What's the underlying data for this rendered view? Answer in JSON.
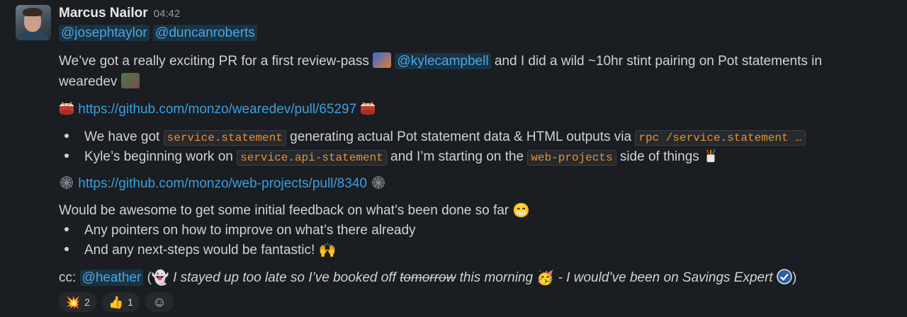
{
  "message": {
    "author": "Marcus Nailor",
    "time": "04:42",
    "mentions_top": [
      "@josephtaylor",
      "@duncanroberts"
    ],
    "p1": {
      "a": "We’ve got a really exciting PR for a first review-pass",
      "mention": "@kylecampbell",
      "b": "and I did a wild ~10hr stint pairing on Pot statements in",
      "c": "wearedev"
    },
    "link1": "https://github.com/monzo/wearedev/pull/65297",
    "bullets1": [
      {
        "a": "We have got",
        "code1": "service.statement",
        "b": "generating actual Pot statement data & HTML outputs via",
        "code2": "rpc /service.statement …"
      },
      {
        "a": "Kyle’s beginning work on",
        "code1": "service.api-statement",
        "b": "and I’m starting on the",
        "code2": "web-projects",
        "c": "side of things"
      }
    ],
    "link2": "https://github.com/monzo/web-projects/pull/8340",
    "p2": "Would be awesome to get some initial feedback on what’s been done so far",
    "bullets2": [
      "Any pointers on how to improve on what’s there already",
      "And any next-steps would be fantastic!"
    ],
    "cc": {
      "label": "cc:",
      "mention": "@heather",
      "open": "(",
      "italic1": "I stayed up too late so I’ve booked off",
      "strike": "tomorrow",
      "italic2": "this morning",
      "italic3": "- I would’ve been on Savings Expert",
      "close": ")"
    },
    "reactions": [
      {
        "icon": "collision-icon",
        "glyph": "💥",
        "count": "2"
      },
      {
        "icon": "thumbs-up-icon",
        "glyph": "👍",
        "count": "1"
      }
    ],
    "add_reaction_glyph": "☺"
  },
  "colors": {
    "background": "#1a1d21",
    "mention": "#4aa6e8",
    "link": "#3aa0df",
    "code": "#e8912d"
  }
}
